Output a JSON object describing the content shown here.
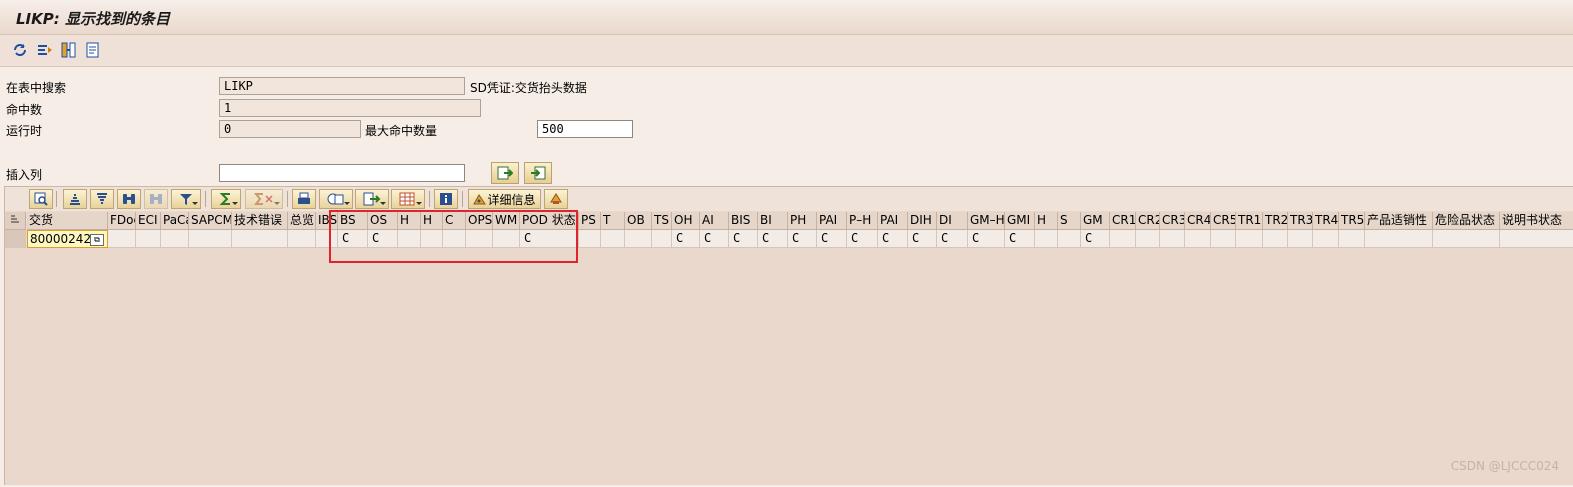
{
  "window": {
    "title": "LIKP: 显示找到的条目"
  },
  "app_toolbar": {
    "icons": [
      "refresh-icon",
      "selection-screen-icon",
      "change-layout-icon",
      "list-icon"
    ]
  },
  "selection": {
    "table_label": "在表中搜索",
    "table_value": "LIKP",
    "table_desc": "SD凭证:交货抬头数据",
    "hits_label": "命中数",
    "hits_value": "1",
    "runtime_label": "运行时",
    "runtime_value": "0",
    "max_hits_label": "最大命中数量",
    "max_hits_value": "500",
    "insert_col_label": "插入列",
    "insert_col_value": ""
  },
  "alv_toolbar": {
    "details_label": "详细信息"
  },
  "grid": {
    "columns": [
      {
        "label": "交货",
        "value": "80000242"
      },
      {
        "label": "FDoc",
        "value": ""
      },
      {
        "label": "ECI",
        "value": ""
      },
      {
        "label": "PaCa",
        "value": ""
      },
      {
        "label": "SAPCM",
        "value": ""
      },
      {
        "label": "技术错误",
        "value": ""
      },
      {
        "label": "总览",
        "value": ""
      },
      {
        "label": "IBS",
        "value": ""
      },
      {
        "label": "BS",
        "value": "C"
      },
      {
        "label": "OS",
        "value": "C"
      },
      {
        "label": "H",
        "value": ""
      },
      {
        "label": "H",
        "value": ""
      },
      {
        "label": "C",
        "value": ""
      },
      {
        "label": "OPS",
        "value": ""
      },
      {
        "label": "WM",
        "value": ""
      },
      {
        "label": "POD 状态",
        "value": "C"
      },
      {
        "label": "PS",
        "value": ""
      },
      {
        "label": "T",
        "value": ""
      },
      {
        "label": "OB",
        "value": ""
      },
      {
        "label": "TS",
        "value": ""
      },
      {
        "label": "OH",
        "value": "C"
      },
      {
        "label": "AI",
        "value": "C"
      },
      {
        "label": "BIS",
        "value": "C"
      },
      {
        "label": "BI",
        "value": "C"
      },
      {
        "label": "PH",
        "value": "C"
      },
      {
        "label": "PAI",
        "value": "C"
      },
      {
        "label": "P–H",
        "value": "C"
      },
      {
        "label": "PAI",
        "value": "C"
      },
      {
        "label": "DIH",
        "value": "C"
      },
      {
        "label": "DI",
        "value": "C"
      },
      {
        "label": "GM–H",
        "value": "C"
      },
      {
        "label": "GMI",
        "value": "C"
      },
      {
        "label": "H",
        "value": ""
      },
      {
        "label": "S",
        "value": ""
      },
      {
        "label": "GM",
        "value": "C"
      },
      {
        "label": "CR1",
        "value": ""
      },
      {
        "label": "CR2",
        "value": ""
      },
      {
        "label": "CR3",
        "value": ""
      },
      {
        "label": "CR4",
        "value": ""
      },
      {
        "label": "CR5",
        "value": ""
      },
      {
        "label": "TR1",
        "value": ""
      },
      {
        "label": "TR2",
        "value": ""
      },
      {
        "label": "TR3",
        "value": ""
      },
      {
        "label": "TR4",
        "value": ""
      },
      {
        "label": "TR5",
        "value": ""
      },
      {
        "label": "产品适销性",
        "value": ""
      },
      {
        "label": "危险品状态",
        "value": ""
      },
      {
        "label": "说明书状态",
        "value": ""
      }
    ]
  },
  "watermark": "CSDN @LJCCC024",
  "colors": {
    "highlight": "#e1232b",
    "key_cell": "#fdf7c2"
  }
}
